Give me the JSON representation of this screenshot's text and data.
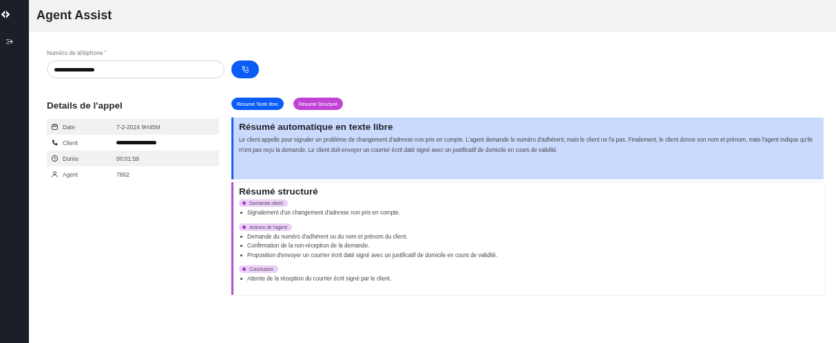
{
  "header": {
    "title": "Agent Assist"
  },
  "phone": {
    "label": "Numéro de téléphone",
    "required_mark": "*",
    "redacted": true
  },
  "details": {
    "title": "Details de l'appel",
    "rows": [
      {
        "kind": "date",
        "label": "Date",
        "value": "7-2-2024 9H45M",
        "redacted": false
      },
      {
        "kind": "phone",
        "label": "Client",
        "redacted": true
      },
      {
        "kind": "clock",
        "label": "Durée",
        "value": "00:01:59",
        "redacted": false
      },
      {
        "kind": "person",
        "label": "Agent",
        "value": "7862",
        "redacted": false
      }
    ]
  },
  "summary_tabs": [
    {
      "label": "Résumé Texte libre",
      "color": "#0a5cf5"
    },
    {
      "label": "Résumé Structuré",
      "color": "#c043d6"
    }
  ],
  "free_summary": {
    "title": "Résumé automatique en texte libre",
    "text": "Le client appelle pour signaler un problème de changement d'adresse non pris en compte. L'agent demande le numéro d'adhérent, mais le client ne l'a pas. Finalement, le client donne son nom et prénom, mais l'agent indique qu'ils n'ont pas reçu la demande. Le client doit envoyer un courrier écrit daté signé avec un justificatif de domicile en cours de validité."
  },
  "structured_summary": {
    "title": "Résumé structuré",
    "sections": [
      {
        "tag": "Demande client",
        "items": [
          "Signalement d'un changement d'adresse non pris en compte."
        ]
      },
      {
        "tag": "Actions de l'agent",
        "items": [
          "Demande du numéro d'adhérent ou du nom et prénom du client.",
          "Confirmation de la non-réception de la demande.",
          "Proposition d'envoyer un courrier écrit daté signé avec un justificatif de domicile en cours de validité."
        ]
      },
      {
        "tag": "Conclusion",
        "items": [
          "Attente de la réception du courrier écrit signé par le client."
        ]
      }
    ]
  }
}
